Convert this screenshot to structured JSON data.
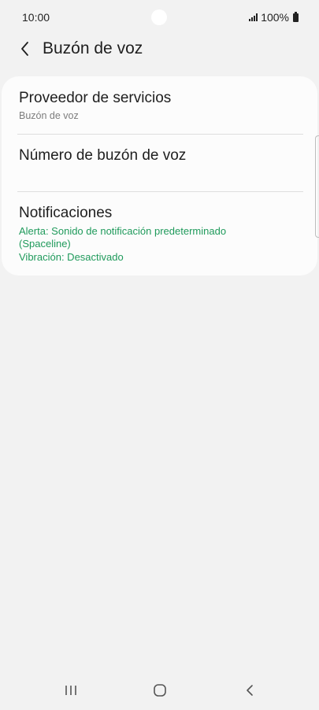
{
  "status_bar": {
    "time": "10:00",
    "battery_text": "100%"
  },
  "header": {
    "title": "Buzón de voz"
  },
  "settings": {
    "provider": {
      "title": "Proveedor de servicios",
      "subtitle": "Buzón de voz"
    },
    "number": {
      "title": "Número de buzón de voz"
    },
    "notifications": {
      "title": "Notificaciones",
      "alert": "Alerta: Sonido de notificación predeterminado (Spaceline)",
      "vibration": "Vibración: Desactivado"
    }
  },
  "colors": {
    "background": "#f2f2f2",
    "card": "#fcfcfc",
    "accent_green": "#1f9a5b",
    "subtitle_gray": "#7d7d7d"
  },
  "icons": {
    "back": "chevron-left-icon",
    "signal": "signal-icon",
    "battery": "battery-icon",
    "recent": "recent-apps-icon",
    "home": "home-icon",
    "nav_back": "back-arrow-icon"
  }
}
